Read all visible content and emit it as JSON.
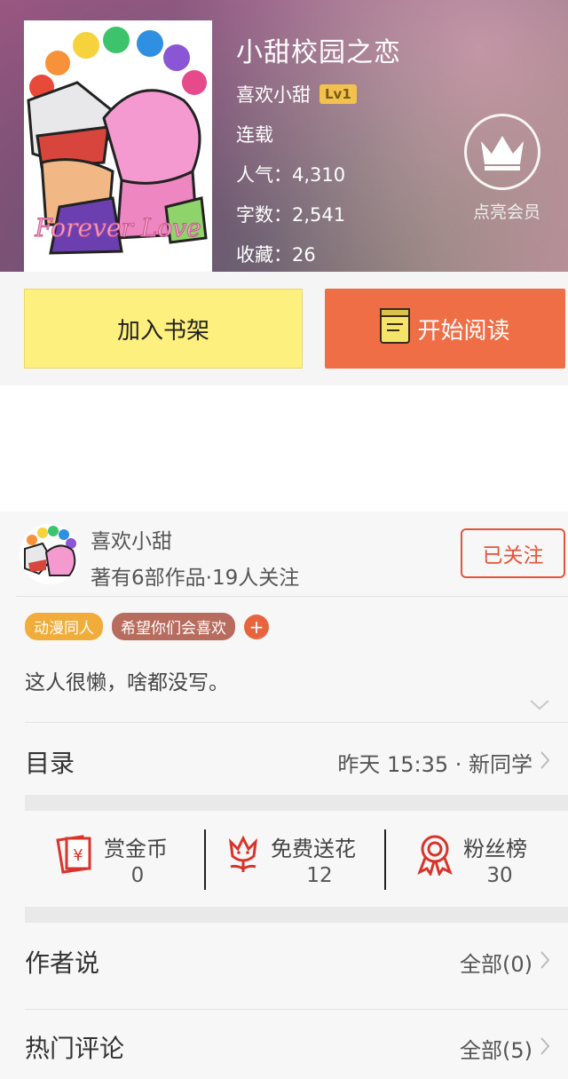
{
  "book": {
    "title": "小甜校园之恋",
    "author": "喜欢小甜",
    "level": "Lv1",
    "status": "连载",
    "popularity": "人气：4,310",
    "word_count": "字数：2,541",
    "favorites": "收藏：26",
    "cover_text": "Forever Love"
  },
  "vip": {
    "label": "点亮会员"
  },
  "actions": {
    "add_shelf": "加入书架",
    "start_read": "开始阅读"
  },
  "author_card": {
    "name": "喜欢小甜",
    "stats": "著有6部作品·19人关注",
    "follow_label": "已关注",
    "tags": [
      "动漫同人",
      "希望你们会喜欢"
    ],
    "add_tag": "+",
    "intro": "这人很懒，啥都没写。"
  },
  "catalog": {
    "title": "目录",
    "update": "昨天 15:35 · 新同学"
  },
  "stats": [
    {
      "label": "赏金币",
      "value": "0",
      "icon": "red-envelope-icon"
    },
    {
      "label": "免费送花",
      "value": "12",
      "icon": "flower-icon"
    },
    {
      "label": "粉丝榜",
      "value": "30",
      "icon": "ribbon-medal-icon"
    }
  ],
  "author_says": {
    "title": "作者说",
    "link": "全部(0)"
  },
  "hot_comments": {
    "title": "热门评论",
    "link": "全部(5)"
  },
  "colors": {
    "accent": "#ef6e45",
    "shelf_button": "#fdf07f",
    "level_badge": "#f2c14e",
    "icon_red": "#d9342b"
  }
}
